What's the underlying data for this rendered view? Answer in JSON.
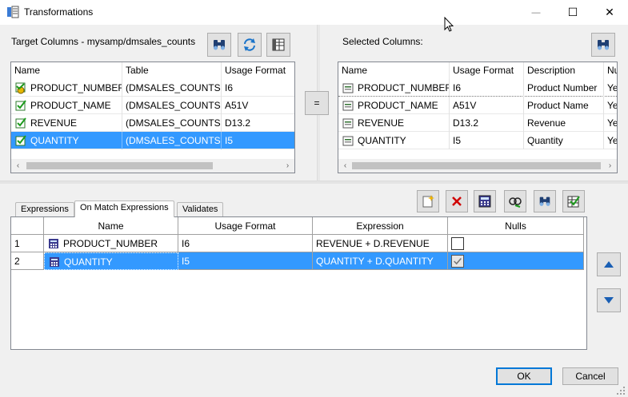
{
  "window": {
    "title": "Transformations",
    "minimize_glyph": "—",
    "maximize_glyph": "☐",
    "close_glyph": "✕"
  },
  "target_panel": {
    "label": "Target Columns - mysamp/dmsales_counts",
    "columns": [
      "Name",
      "Table",
      "Usage Format"
    ],
    "rows": [
      {
        "name": "PRODUCT_NUMBER",
        "table": "(DMSALES_COUNTS)",
        "format": "I6",
        "icon": "key-column-icon"
      },
      {
        "name": "PRODUCT_NAME",
        "table": "(DMSALES_COUNTS)",
        "format": "A51V",
        "icon": "checked-column-icon"
      },
      {
        "name": "REVENUE",
        "table": "(DMSALES_COUNTS)",
        "format": "D13.2",
        "icon": "checked-column-icon"
      },
      {
        "name": "QUANTITY",
        "table": "(DMSALES_COUNTS)",
        "format": "I5",
        "icon": "checked-column-icon"
      }
    ],
    "selected_row": 3
  },
  "equals_button": "=",
  "selected_panel": {
    "label": "Selected Columns:",
    "columns": [
      "Name",
      "Usage Format",
      "Description",
      "Nu"
    ],
    "rows": [
      {
        "name": "PRODUCT_NUMBER",
        "format": "I6",
        "description": "Product Number",
        "nulls": "Ye"
      },
      {
        "name": "PRODUCT_NAME",
        "format": "A51V",
        "description": "Product Name",
        "nulls": "Ye"
      },
      {
        "name": "REVENUE",
        "format": "D13.2",
        "description": "Revenue",
        "nulls": "Ye"
      },
      {
        "name": "QUANTITY",
        "format": "I5",
        "description": "Quantity",
        "nulls": "Ye"
      }
    ]
  },
  "tabs": [
    {
      "label": "Expressions",
      "active": false
    },
    {
      "label": "On Match Expressions",
      "active": true
    },
    {
      "label": "Validates",
      "active": false
    }
  ],
  "expressions_grid": {
    "columns": [
      "Name",
      "Usage Format",
      "Expression",
      "Nulls"
    ],
    "rows": [
      {
        "num": "1",
        "name": "PRODUCT_NUMBER",
        "format": "I6",
        "expression": "REVENUE + D.REVENUE",
        "nulls": false
      },
      {
        "num": "2",
        "name": "QUANTITY",
        "format": "I5",
        "expression": "QUANTITY + D.QUANTITY",
        "nulls": true
      }
    ],
    "selected_row": 1
  },
  "toolbar_icons": [
    "new-expression-icon",
    "delete-icon",
    "calculator-icon",
    "replace-icon",
    "find-icon",
    "validate-icon"
  ],
  "buttons": {
    "ok": "OK",
    "cancel": "Cancel"
  },
  "colors": {
    "selection": "#3399ff",
    "delete_red": "#d00000",
    "default_button_border": "#0078d7"
  }
}
